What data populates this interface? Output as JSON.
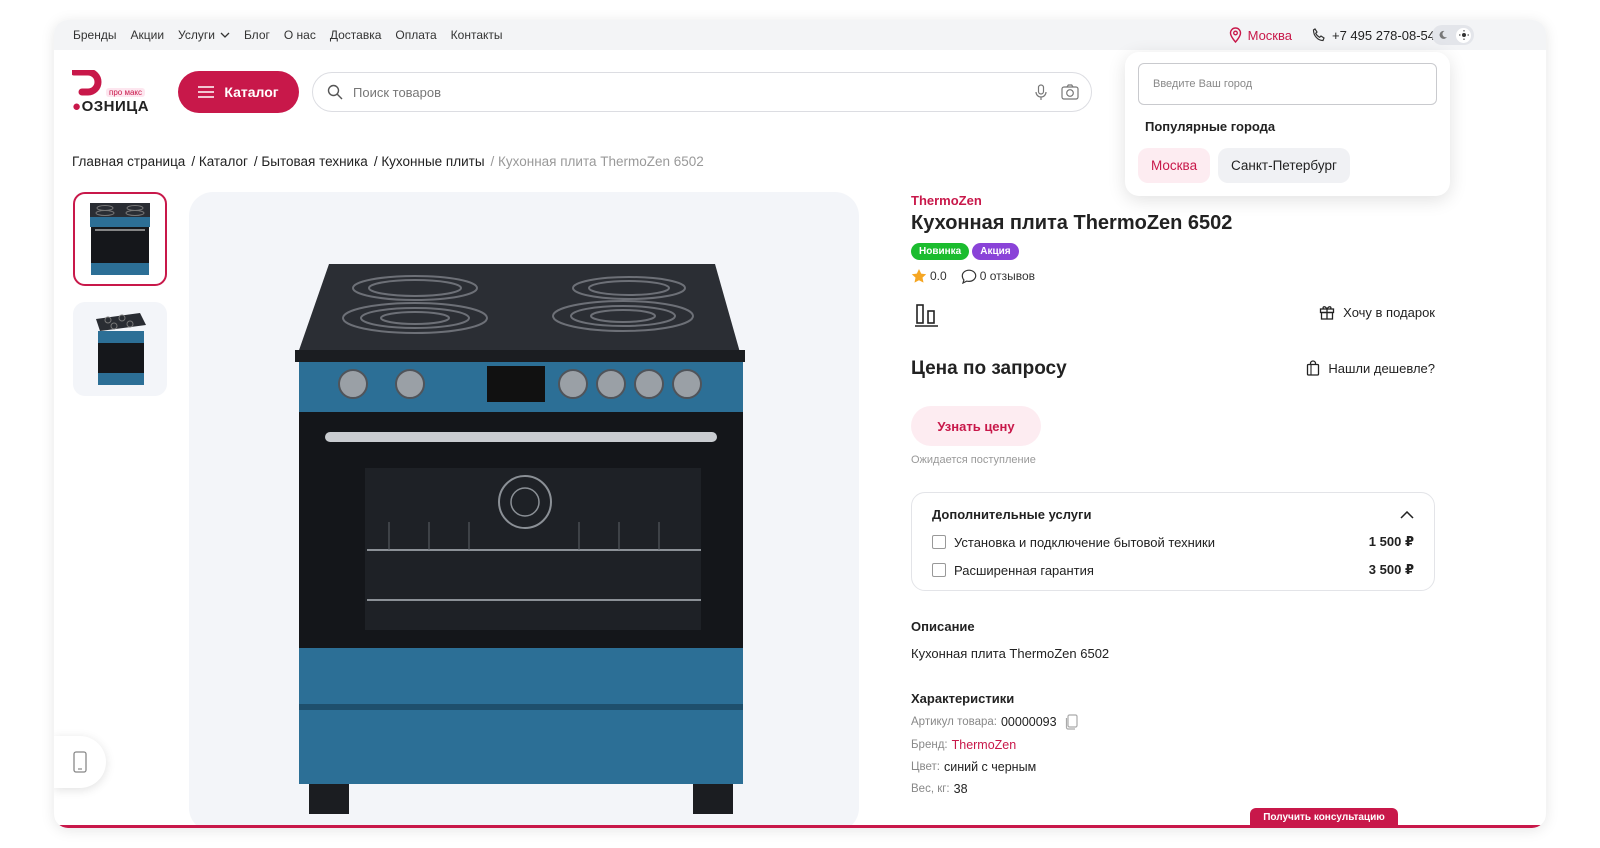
{
  "topnav": {
    "items": [
      "Бренды",
      "Акции",
      "Услуги",
      "Блог",
      "О нас",
      "Доставка",
      "Оплата",
      "Контакты"
    ],
    "city": "Москва",
    "phone": "+7 495 278-08-54"
  },
  "header": {
    "logo_tag": "про макс",
    "logo_word": "ОЗНИЦА",
    "catalog_label": "Каталог",
    "search_placeholder": "Поиск товаров"
  },
  "breadcrumb": [
    "Главная страница",
    "/ Каталог",
    "/ Бытовая техника",
    "/ Кухонные плиты",
    "/ Кухонная плита ThermoZen 6502"
  ],
  "product": {
    "brand": "ThermoZen",
    "title": "Кухонная плита ThermoZen 6502",
    "badges": [
      "Новинка",
      "Акция"
    ],
    "rating": "0.0",
    "reviews": "0 отзывов",
    "gift_label": "Хочу в подарок",
    "price": "Цена по запросу",
    "cheaper_label": "Нашли дешевле?",
    "price_button": "Узнать цену",
    "status": "Ожидается поступление"
  },
  "services": {
    "title": "Дополнительные услуги",
    "items": [
      {
        "label": "Установка и подключение бытовой техники",
        "price": "1 500 ₽"
      },
      {
        "label": "Расширенная гарантия",
        "price": "3 500 ₽"
      }
    ]
  },
  "description": {
    "title": "Описание",
    "text": "Кухонная плита ThermoZen 6502"
  },
  "characteristics": {
    "title": "Характеристики",
    "items": [
      {
        "key": "Артикул товара:",
        "value": "00000093"
      },
      {
        "key": "Бренд:",
        "value": "ThermoZen"
      },
      {
        "key": "Цвет:",
        "value": "синий с черным"
      },
      {
        "key": "Вес, кг:",
        "value": "38"
      }
    ]
  },
  "city_dropdown": {
    "placeholder": "Введите Ваш город",
    "popular_title": "Популярные города",
    "cities": [
      "Москва",
      "Санкт-Петербург"
    ]
  },
  "consult_label": "Получить консультацию",
  "colors": {
    "accent": "#c8184a",
    "new_badge": "#1bbc2e",
    "promo_badge": "#8a43d8",
    "oven_blue": "#2c6f96"
  }
}
